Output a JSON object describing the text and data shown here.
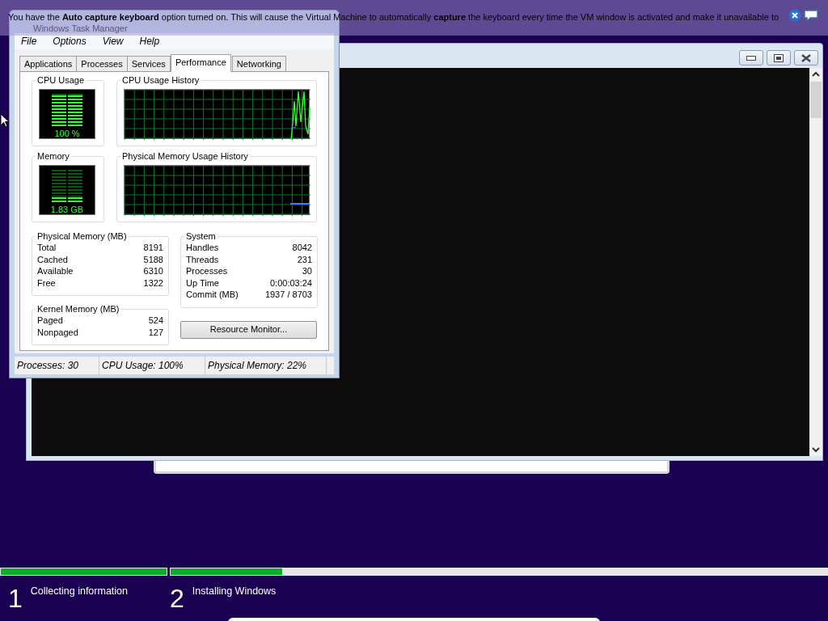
{
  "notification": {
    "text": "You have the **Auto capture keyboard** option turned on. This will cause the Virtual Machine to automatically **capture** the keyboard every time the VM window is activated and make it unavailable to"
  },
  "task_manager": {
    "title": "Windows Task Manager",
    "menu": [
      "File",
      "Options",
      "View",
      "Help"
    ],
    "tabs": [
      {
        "label": "Applications",
        "selected": false
      },
      {
        "label": "Processes",
        "selected": false
      },
      {
        "label": "Services",
        "selected": false
      },
      {
        "label": "Performance",
        "selected": true
      },
      {
        "label": "Networking",
        "selected": false
      }
    ],
    "cpu_usage": {
      "label": "CPU Usage",
      "reading": "100 %",
      "level": 1
    },
    "cpu_history": {
      "label": "CPU Usage History"
    },
    "memory": {
      "label": "Memory",
      "reading": "1.83 GB",
      "level": 0.22
    },
    "memory_history": {
      "label": "Physical Memory Usage History"
    },
    "physical_memory": {
      "title": "Physical Memory (MB)",
      "rows": [
        {
          "label": "Total",
          "value": "8191"
        },
        {
          "label": "Cached",
          "value": "5188"
        },
        {
          "label": "Available",
          "value": "6310"
        },
        {
          "label": "Free",
          "value": "1322"
        }
      ]
    },
    "kernel_memory": {
      "title": "Kernel Memory (MB)",
      "rows": [
        {
          "label": "Paged",
          "value": "524"
        },
        {
          "label": "Nonpaged",
          "value": "127"
        }
      ]
    },
    "system": {
      "title": "System",
      "rows": [
        {
          "label": "Handles",
          "value": "8042"
        },
        {
          "label": "Threads",
          "value": "231"
        },
        {
          "label": "Processes",
          "value": "30"
        },
        {
          "label": "Up Time",
          "value": "0:00:03:24"
        },
        {
          "label": "Commit (MB)",
          "value": "1937 / 8703"
        }
      ]
    },
    "button": "Resource Monitor...",
    "status_bar": [
      "Processes: 30",
      "CPU Usage: 100%",
      "Physical Memory: 22%"
    ]
  },
  "setup": {
    "progress": [
      {
        "level": 1
      },
      {
        "level": 0.17
      }
    ],
    "steps": [
      {
        "number": "1",
        "label": "Collecting information"
      },
      {
        "number": "2",
        "label": "Installing Windows"
      }
    ]
  }
}
